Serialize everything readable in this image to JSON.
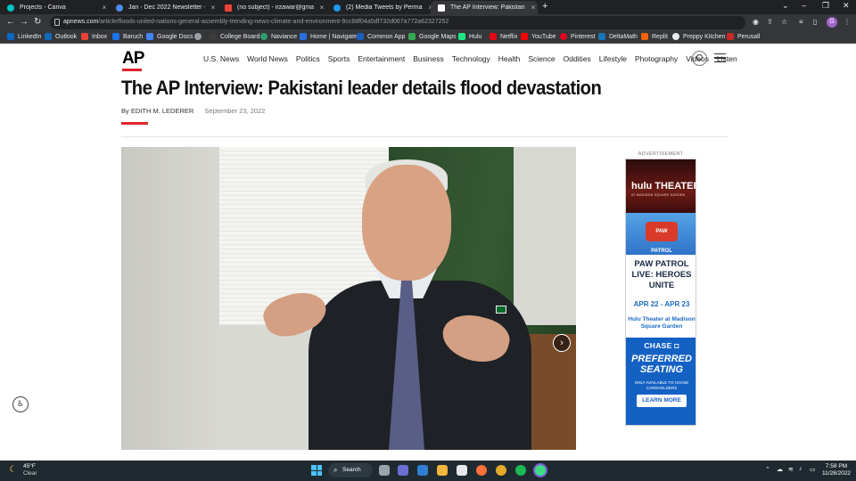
{
  "browser": {
    "tabs": [
      {
        "title": "Projects - Canva",
        "close": "×"
      },
      {
        "title": "Jan - Dec 2022 Newsletter - US |",
        "close": "×"
      },
      {
        "title": "(no subject) - irzawar@gmail.cor",
        "close": "×"
      },
      {
        "title": "(2) Media Tweets by Permanent I",
        "close": "×"
      },
      {
        "title": "The AP Interview: Pakistani leade",
        "close": "×"
      }
    ],
    "new_tab": "+",
    "url_host": "apnews.com",
    "url_path": "/article/floods-united-nations-general-assembly-trending-news-climate-and-environment-9cc68f04a5df732d067a772a62327252",
    "profile_initial": "G",
    "bookmarks": [
      {
        "label": "LinkedIn",
        "color": "#0a66c2"
      },
      {
        "label": "Outlook",
        "color": "#0f6cbd"
      },
      {
        "label": "Inbox",
        "color": "#ea4335"
      },
      {
        "label": "Baruch",
        "color": "#1a73e8"
      },
      {
        "label": "Google Docs",
        "color": "#4285f4"
      },
      {
        "label": "",
        "color": "#9aa0a6"
      },
      {
        "label": "College Board",
        "color": "#3c3c3c"
      },
      {
        "label": "Naviance",
        "color": "#2e9e6a"
      },
      {
        "label": "Home | Navigate",
        "color": "#2a6fdb"
      },
      {
        "label": "Common App",
        "color": "#1c5fb8"
      },
      {
        "label": "Google Maps",
        "color": "#34a853"
      },
      {
        "label": "Hulu",
        "color": "#1ce783"
      },
      {
        "label": "Netflix",
        "color": "#e50914"
      },
      {
        "label": "YouTube",
        "color": "#ff0000"
      },
      {
        "label": "Pinterest",
        "color": "#e60023"
      },
      {
        "label": "DeltaMath",
        "color": "#1b75bb"
      },
      {
        "label": "Replit",
        "color": "#f26207"
      },
      {
        "label": "Preppy Kitchen",
        "color": "#e8eaed"
      },
      {
        "label": "Perusall",
        "color": "#c62828"
      }
    ]
  },
  "site": {
    "logo": "AP",
    "nav": [
      "U.S. News",
      "World News",
      "Politics",
      "Sports",
      "Entertainment",
      "Business",
      "Technology",
      "Health",
      "Science",
      "Oddities",
      "Lifestyle",
      "Photography",
      "Videos",
      "Listen"
    ]
  },
  "article": {
    "headline": "The AP Interview: Pakistani leader details flood devastation",
    "byline_prefix": "By",
    "author": "EDITH M. LEDERER",
    "date": "September 23, 2022",
    "next_arrow": "›"
  },
  "ad": {
    "label": "ADVERTISEMENT",
    "brand": "hulu THEATER",
    "brand_sub": "AT MADISON SQUARE GARDEN",
    "badge": "PAW PATROL",
    "title": "PAW PATROL LIVE: HEROES UNITE",
    "dates": "APR 22 - APR 23",
    "venue": "Hulu Theater at Madison Square Garden",
    "sponsor": "CHASE ◘",
    "preferred": "PREFERRED SEATING",
    "only": "ONLY AVAILABLE TO CHASE CARDHOLDERS",
    "cta": "LEARN MORE"
  },
  "taskbar": {
    "temp": "45°F",
    "condition": "Clear",
    "search": "Search",
    "time": "7:58 PM",
    "date": "11/28/2022"
  }
}
